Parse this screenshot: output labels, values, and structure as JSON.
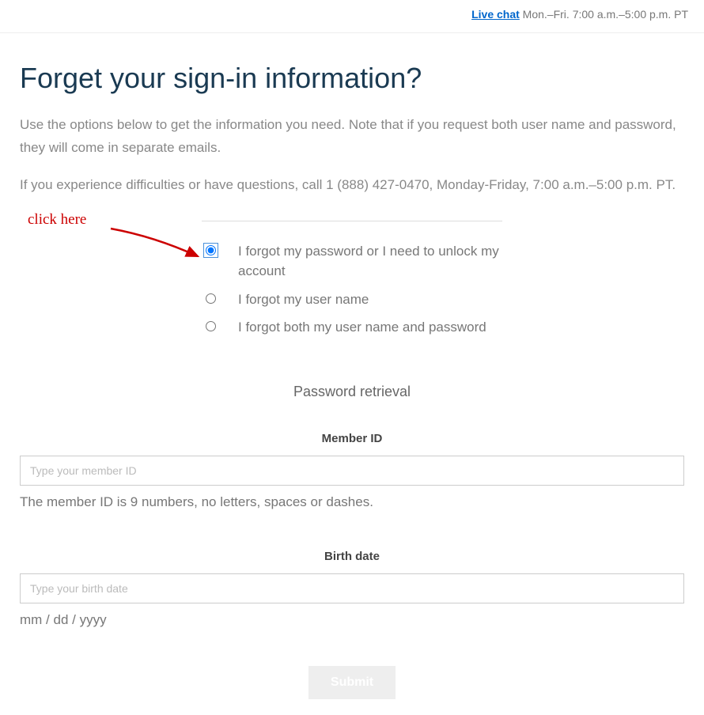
{
  "header": {
    "live_chat_link": "Live chat",
    "live_chat_hours": " Mon.–Fri. 7:00 a.m.–5:00 p.m. PT"
  },
  "page": {
    "title": "Forget your sign-in information?",
    "intro1": "Use the options below to get the information you need. Note that if you request both user name and password, they will come in separate emails.",
    "intro2": "If you experience difficulties or have questions, call 1 (888) 427-0470, Monday-Friday, 7:00 a.m.–5:00 p.m. PT."
  },
  "annotation": {
    "text": "click here"
  },
  "options": {
    "opt1": "I forgot my password or I need to unlock my account",
    "opt2": "I forgot my user name",
    "opt3": "I forgot both my user name and password"
  },
  "retrieval": {
    "section_title": "Password retrieval",
    "member_id_label": "Member ID",
    "member_id_placeholder": "Type your member ID",
    "member_id_helper": "The member ID is 9 numbers, no letters, spaces or dashes.",
    "birth_date_label": "Birth date",
    "birth_date_placeholder": "Type your birth date",
    "birth_date_helper": "mm / dd / yyyy",
    "submit_label": "Submit"
  }
}
